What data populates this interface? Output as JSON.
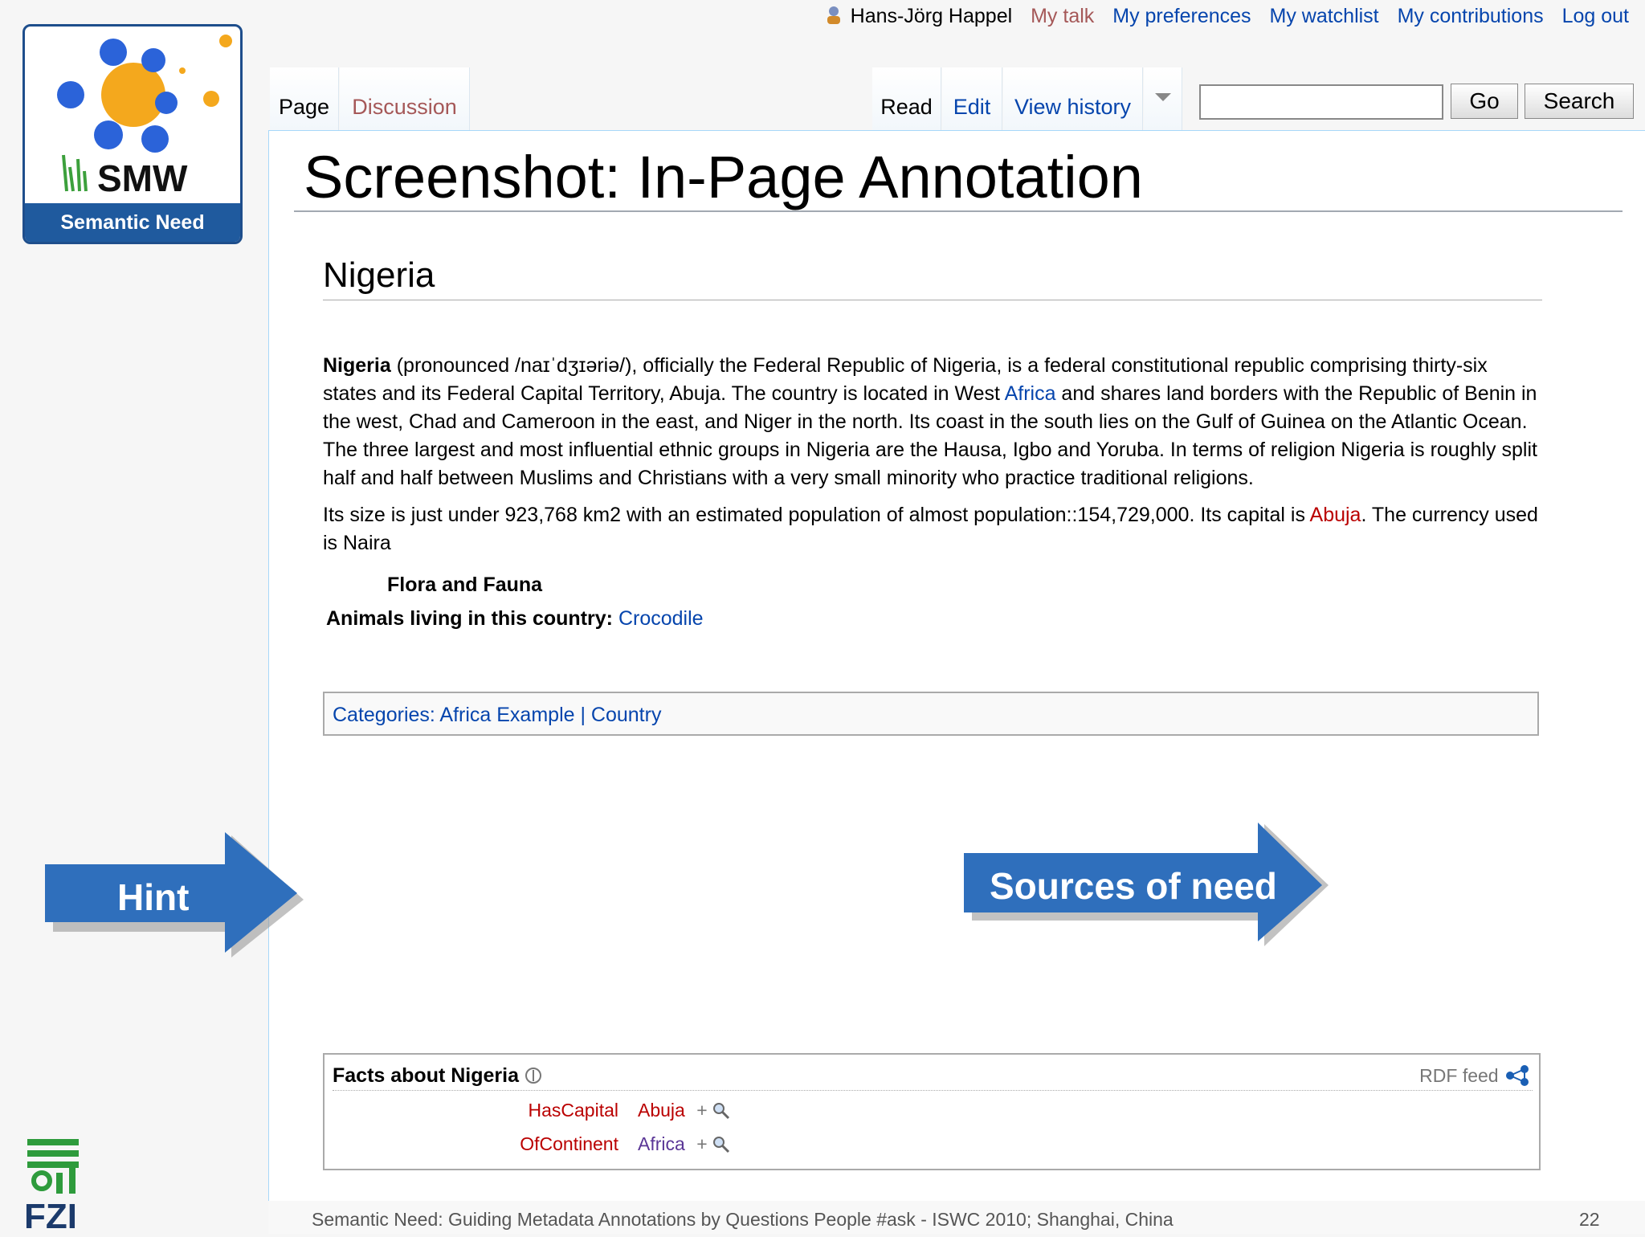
{
  "logo": {
    "text": "SMW",
    "caption": "Semantic Need"
  },
  "personal": {
    "user": "Hans-Jörg Happel",
    "talk": "My talk",
    "preferences": "My preferences",
    "watchlist": "My watchlist",
    "contributions": "My contributions",
    "logout": "Log out"
  },
  "tabs": {
    "page": "Page",
    "discussion": "Discussion",
    "read": "Read",
    "edit": "Edit",
    "history": "View history"
  },
  "search": {
    "value": "",
    "go": "Go",
    "search": "Search"
  },
  "slide_title": "Screenshot: In-Page Annotation",
  "article": {
    "heading": "Nigeria",
    "p1": {
      "bold": "Nigeria",
      "a": " (pronounced /naɪˈdʒɪəriə/), officially the Federal Republic of Nigeria, is a federal constitutional republic comprising thirty-six states and its Federal Capital Territory, Abuja. The country is located in West ",
      "africa": "Africa",
      "b": " and shares land borders with the Republic of Benin in the west, Chad and Cameroon in the east, and Niger in the north. Its coast in the south lies on the Gulf of Guinea on the Atlantic Ocean. The three largest and most influential ethnic groups in Nigeria are the Hausa, Igbo and Yoruba. In terms of religion Nigeria is roughly split half and half between Muslims and Christians with a very small minority who practice traditional religions."
    },
    "p2": {
      "a": "Its size is just under 923,768 km2 with an estimated population of almost population::154,729,000. Its capital is ",
      "abuja": "Abuja",
      "b": ". The currency used is Naira"
    },
    "flora_heading": "Flora and Fauna",
    "animals_label": "Animals living in this country:",
    "animals_value": "Crocodile",
    "categories": "Categories: Africa Example | Country"
  },
  "facts": {
    "title": "Facts about Nigeria",
    "rdf": "RDF feed",
    "rows": [
      {
        "prop": "HasCapital",
        "value": "Abuja",
        "plus": "+"
      },
      {
        "prop": "OfContinent",
        "value": "Africa",
        "plus": "+"
      }
    ]
  },
  "arrows": {
    "hint": "Hint",
    "sources": "Sources of need"
  },
  "footer": {
    "text": "Semantic Need: Guiding Metadata Annotations by Questions People #ask - ISWC 2010; Shanghai, China",
    "page": "22",
    "org": "FZI"
  },
  "colors": {
    "link": "#0645ad",
    "redlink": "#ba0000",
    "arrow": "#2f6fbc",
    "logo_bar": "#1f5a9e"
  }
}
